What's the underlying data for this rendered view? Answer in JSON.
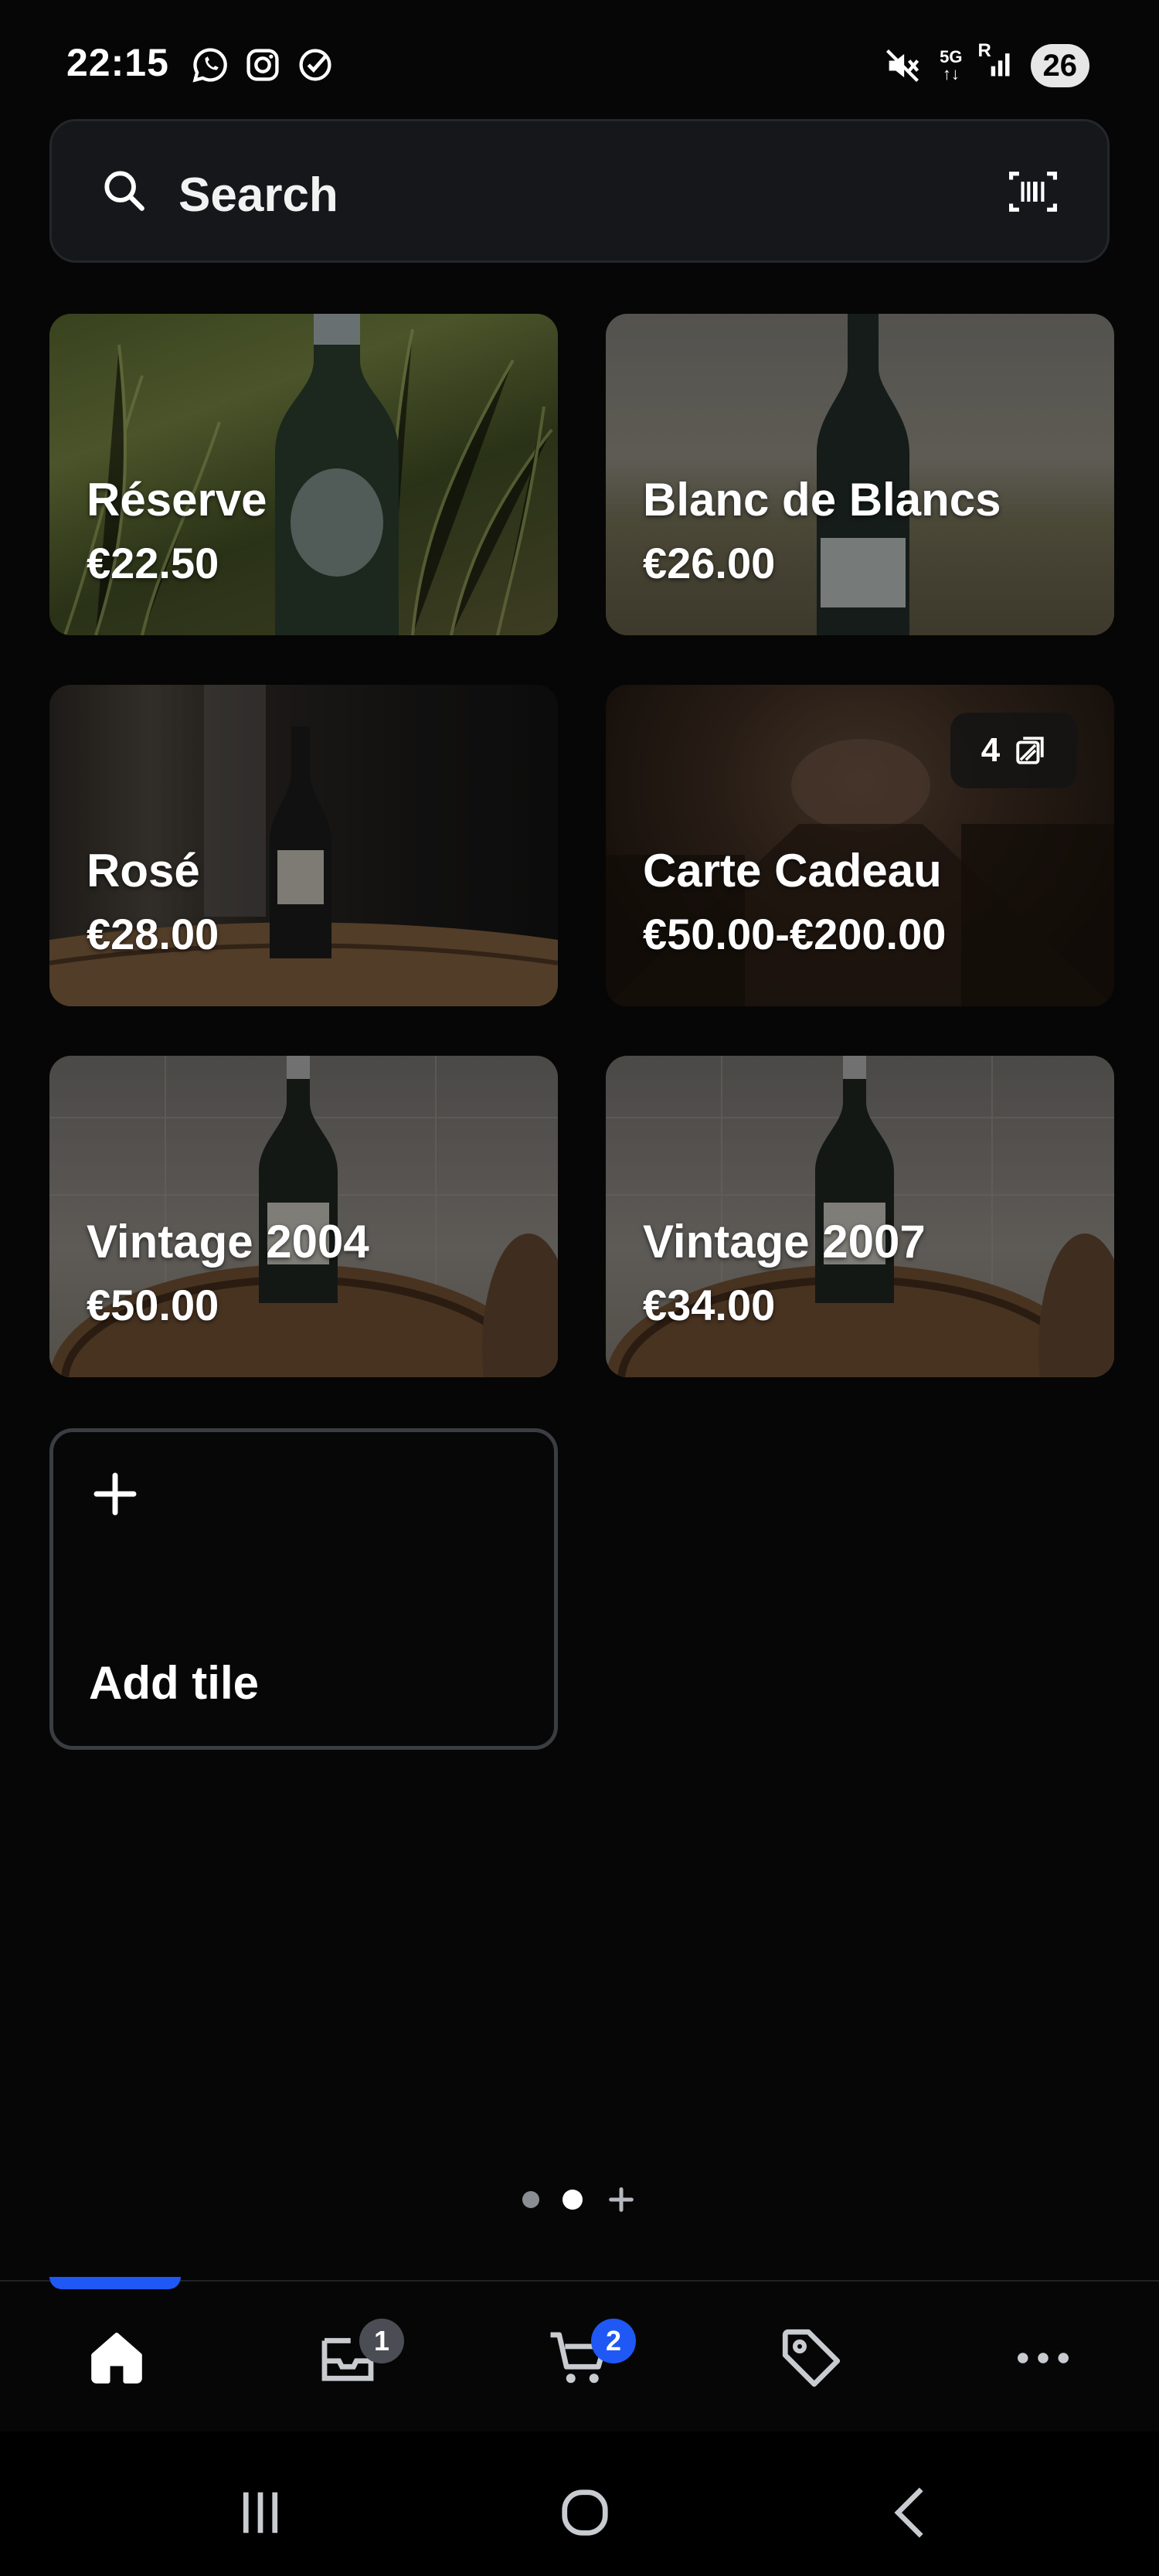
{
  "status_bar": {
    "time": "22:15",
    "left_icons": [
      "whatsapp-icon",
      "instagram-icon",
      "check-circle-icon"
    ],
    "network_top": "5G",
    "network_bottom": "↑↓",
    "signal_label": "R",
    "battery": "26"
  },
  "search": {
    "placeholder": "Search"
  },
  "tiles": [
    {
      "title": "Réserve",
      "price": "€22.50"
    },
    {
      "title": "Blanc de Blancs",
      "price": "€26.00"
    },
    {
      "title": "Rosé",
      "price": "€28.00"
    },
    {
      "title": "Carte Cadeau",
      "price": "€50.00-€200.00",
      "variant_count": "4"
    },
    {
      "title": "Vintage 2004",
      "price": "€50.00"
    },
    {
      "title": "Vintage 2007",
      "price": "€34.00"
    }
  ],
  "add_tile": {
    "label": "Add tile"
  },
  "pagination": {
    "pages": 2,
    "current": 2
  },
  "bottom_nav": {
    "items": [
      {
        "name": "home",
        "icon": "home-icon",
        "active": true
      },
      {
        "name": "inbox",
        "icon": "inbox-icon",
        "badge": "1"
      },
      {
        "name": "cart",
        "icon": "cart-icon",
        "badge": "2"
      },
      {
        "name": "tags",
        "icon": "tag-icon"
      },
      {
        "name": "more",
        "icon": "more-icon"
      }
    ]
  },
  "colors": {
    "background": "#060606",
    "accent": "#1f58f5",
    "badge_gray": "#4a4d54",
    "tile_border": "#3a3d42"
  }
}
